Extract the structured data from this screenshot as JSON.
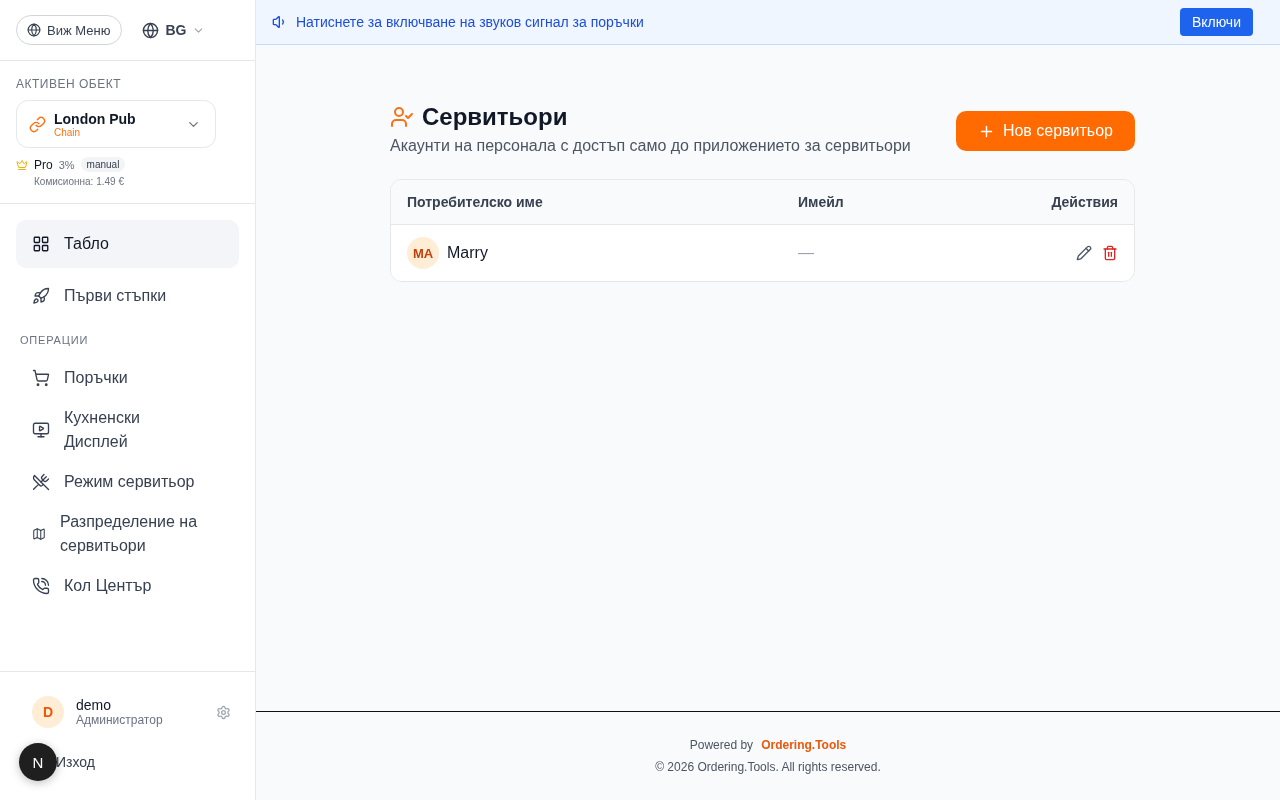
{
  "sidebar": {
    "menu_button": "Виж Меню",
    "language": "BG",
    "active_object": {
      "heading": "АКТИВЕН ОБЕКТ",
      "name": "London Pub",
      "type": "Chain",
      "plan": "Pro",
      "percent": "3%",
      "mode": "manual",
      "commission": "Комисионна: 1.49 €"
    },
    "nav": [
      {
        "kind": "item",
        "label": "Табло",
        "selected": true
      },
      {
        "kind": "item",
        "label": "Първи стъпки",
        "selected": false
      },
      {
        "kind": "section",
        "label": "ОПЕРАЦИИ"
      },
      {
        "kind": "item",
        "label": "Поръчки",
        "selected": false
      },
      {
        "kind": "item",
        "label": "Кухненски Дисплей",
        "selected": false
      },
      {
        "kind": "item",
        "label": "Режим сервитьор",
        "selected": false
      },
      {
        "kind": "item",
        "label": "Разпределение на сервитьори",
        "selected": false
      },
      {
        "kind": "item",
        "label": "Кол Център",
        "selected": false
      }
    ],
    "user": {
      "initial": "D",
      "name": "demo",
      "role": "Администратор"
    },
    "logout": "Изход"
  },
  "dev_badge": "N",
  "banner": {
    "text": "Натиснете за включване на звуков сигнал за поръчки",
    "button": "Включи"
  },
  "page": {
    "title": "Сервитьори",
    "subtitle": "Акаунти на персонала с достъп само до приложението за сервитьори",
    "new_button": "Нов сервитьор"
  },
  "table": {
    "columns": [
      "Потребителско име",
      "Имейл",
      "Действия"
    ],
    "rows": [
      {
        "initials": "MA",
        "name": "Marry",
        "email": "—"
      }
    ]
  },
  "footer": {
    "powered_by": "Powered by",
    "brand": "Ordering.Tools",
    "copyright": "© 2026 Ordering.Tools. All rights reserved."
  }
}
